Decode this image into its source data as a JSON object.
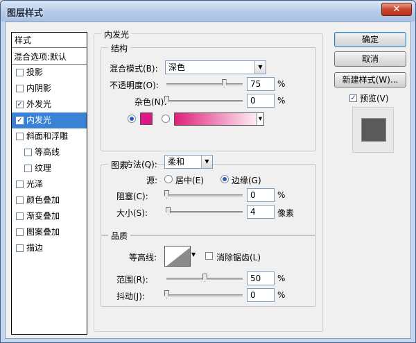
{
  "window": {
    "title": "图层样式",
    "close_icon": "✕"
  },
  "style_list": {
    "header": "样式",
    "blend_options": "混合选项:默认",
    "items": [
      {
        "label": "投影",
        "checked": false,
        "sub": false,
        "selected": false
      },
      {
        "label": "内阴影",
        "checked": false,
        "sub": false,
        "selected": false
      },
      {
        "label": "外发光",
        "checked": true,
        "sub": false,
        "selected": false
      },
      {
        "label": "内发光",
        "checked": true,
        "sub": false,
        "selected": true
      },
      {
        "label": "斜面和浮雕",
        "checked": false,
        "sub": false,
        "selected": false
      },
      {
        "label": "等高线",
        "checked": false,
        "sub": true,
        "selected": false
      },
      {
        "label": "纹理",
        "checked": false,
        "sub": true,
        "selected": false
      },
      {
        "label": "光泽",
        "checked": false,
        "sub": false,
        "selected": false
      },
      {
        "label": "颜色叠加",
        "checked": false,
        "sub": false,
        "selected": false
      },
      {
        "label": "渐变叠加",
        "checked": false,
        "sub": false,
        "selected": false
      },
      {
        "label": "图案叠加",
        "checked": false,
        "sub": false,
        "selected": false
      },
      {
        "label": "描边",
        "checked": false,
        "sub": false,
        "selected": false
      }
    ]
  },
  "panel": {
    "title": "内发光",
    "structure": {
      "title": "结构",
      "blend_mode_label": "混合模式(B):",
      "blend_mode_value": "深色",
      "opacity_label": "不透明度(O):",
      "opacity_value": "75",
      "opacity_unit": "%",
      "opacity_fraction": 0.75,
      "noise_label": "杂色(N):",
      "noise_value": "0",
      "noise_unit": "%",
      "noise_fraction": 0.0,
      "color_swatch": "#e01688",
      "gradient_colors": [
        "#e0207a",
        "#ffffff"
      ]
    },
    "elements": {
      "title": "图素",
      "method_label": "方法(Q):",
      "method_value": "柔和",
      "source_label": "源:",
      "source_center": "居中(E)",
      "source_edge": "边缘(G)",
      "choke_label": "阻塞(C):",
      "choke_value": "0",
      "choke_unit": "%",
      "choke_fraction": 0.0,
      "size_label": "大小(S):",
      "size_value": "4",
      "size_unit": "像素",
      "size_fraction": 0.02
    },
    "quality": {
      "title": "品质",
      "contour_label": "等高线:",
      "antialias_label": "消除锯齿(L)",
      "range_label": "范围(R):",
      "range_value": "50",
      "range_unit": "%",
      "range_fraction": 0.5,
      "jitter_label": "抖动(J):",
      "jitter_value": "0",
      "jitter_unit": "%",
      "jitter_fraction": 0.0
    }
  },
  "buttons": {
    "ok": "确定",
    "cancel": "取消",
    "new_style": "新建样式(W)...",
    "preview_label": "预览(V)",
    "preview_checked": true
  }
}
